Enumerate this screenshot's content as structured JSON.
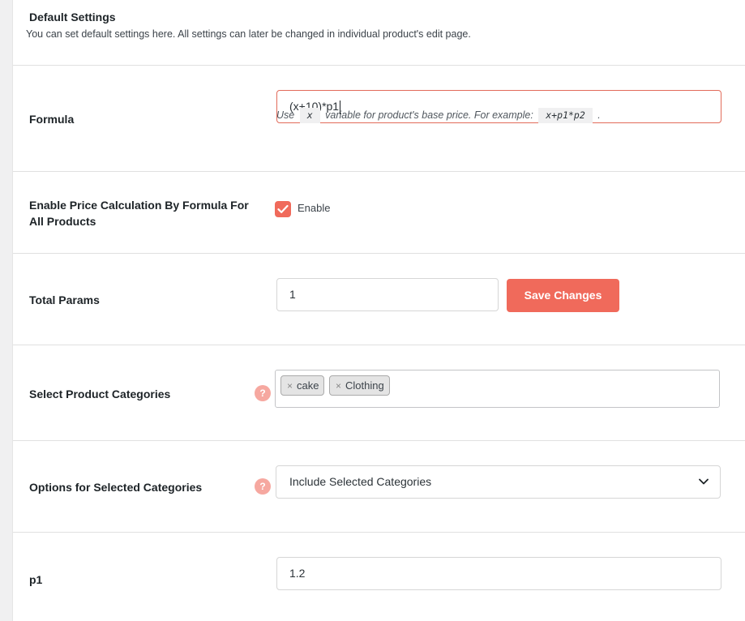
{
  "header": {
    "title": "Default Settings",
    "description": "You can set default settings here. All settings can later be changed in individual product's edit page."
  },
  "formula": {
    "label": "Formula",
    "value": "(x+10)*p1",
    "help_prefix": "Use",
    "help_code_x": "x",
    "help_middle": "variable for product's base price. For example:",
    "help_code_example": "x+p1*p2",
    "help_suffix": "."
  },
  "enable_calc": {
    "label_line1": "Enable Price Calculation By Formula For",
    "label_line2": "All Products",
    "checkbox_label": "Enable",
    "checked": true
  },
  "total_params": {
    "label": "Total Params",
    "value": "1",
    "save_label": "Save Changes"
  },
  "categories": {
    "label": "Select Product Categories",
    "help": "?",
    "tags": [
      {
        "remove": "×",
        "label": "cake"
      },
      {
        "remove": "×",
        "label": "Clothing"
      }
    ]
  },
  "category_options": {
    "label": "Options for Selected Categories",
    "help": "?",
    "selected": "Include Selected Categories"
  },
  "p1": {
    "label": "p1",
    "value": "1.2"
  },
  "colors": {
    "accent": "#f06a5b",
    "help_icon": "#f6a8a0",
    "focus_border": "#e26b5a"
  }
}
